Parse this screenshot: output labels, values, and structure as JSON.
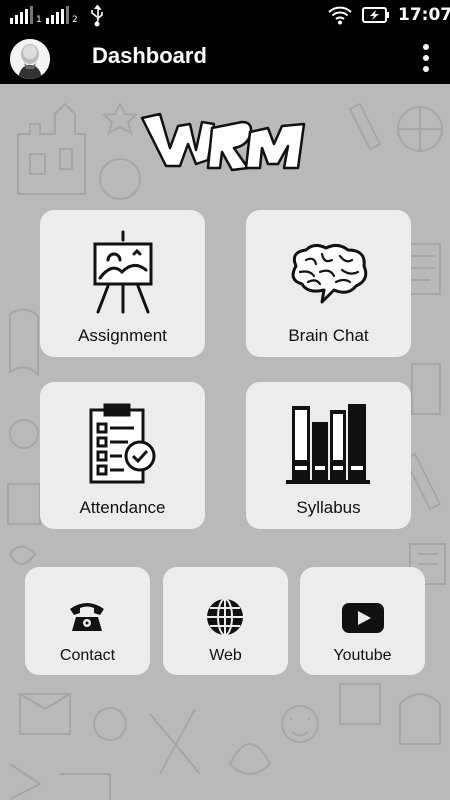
{
  "status_bar": {
    "sim1": "1",
    "sim2": "2",
    "time": "17:07",
    "icons": [
      "signal-icon",
      "signal-icon",
      "usb-icon",
      "wifi-icon",
      "battery-charging-icon"
    ]
  },
  "app_bar": {
    "title": "Dashboard",
    "avatar_icon": "avatar",
    "menu_icon": "more-vert-icon"
  },
  "dashboard": {
    "logo_icon": "logo-graffiti",
    "tiles": [
      {
        "label": "Assignment",
        "icon": "easel-icon"
      },
      {
        "label": "Brain Chat",
        "icon": "brain-chat-icon"
      },
      {
        "label": "Attendance",
        "icon": "checklist-icon"
      },
      {
        "label": "Syllabus",
        "icon": "books-icon"
      }
    ],
    "small_tiles": [
      {
        "label": "Contact",
        "icon": "telephone-icon"
      },
      {
        "label": "Web",
        "icon": "globe-icon"
      },
      {
        "label": "Youtube",
        "icon": "youtube-icon"
      }
    ]
  }
}
